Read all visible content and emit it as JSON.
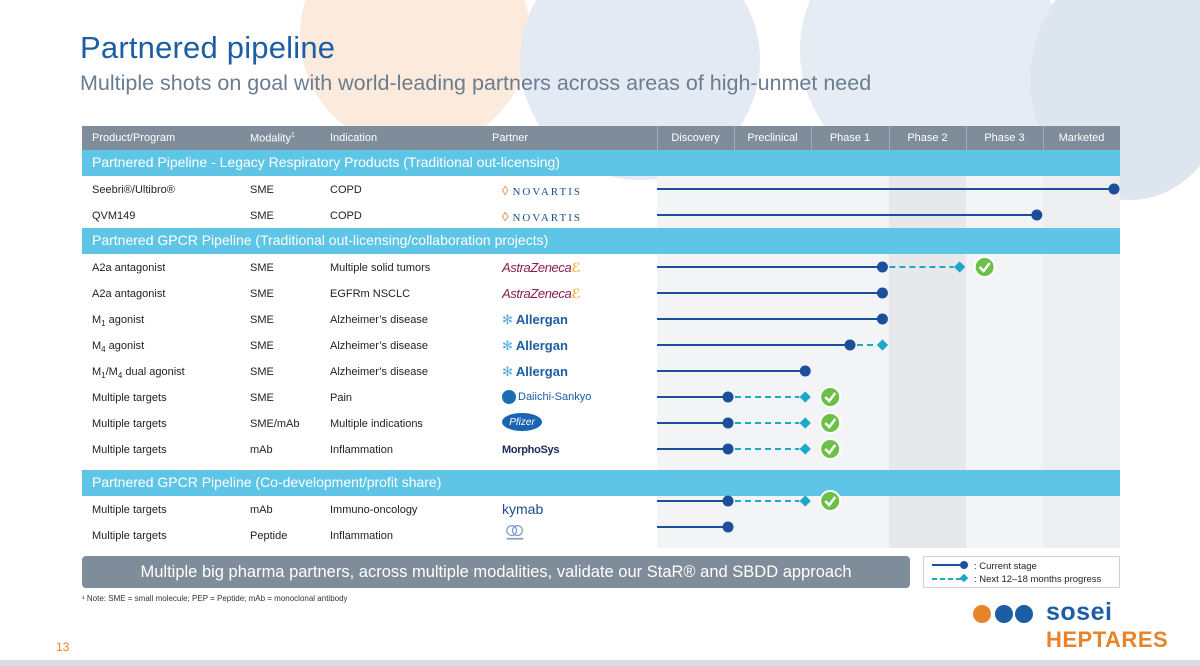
{
  "header": {
    "title": "Partnered pipeline",
    "subtitle": "Multiple shots on goal with world-leading partners across areas of high-unmet need"
  },
  "table": {
    "columns": {
      "product": "Product/Program",
      "modality": "Modality",
      "modality_sup": "1",
      "indication": "Indication",
      "partner": "Partner",
      "stages": [
        "Discovery",
        "Preclinical",
        "Phase 1",
        "Phase 2",
        "Phase 3",
        "Marketed"
      ]
    },
    "sections": [
      {
        "title": "Partnered Pipeline - Legacy Respiratory Products (Traditional out-licensing)",
        "rows": [
          {
            "product": "Seebri®/Ultibro®",
            "modality": "SME",
            "indication": "COPD",
            "partner": "NOVARTIS",
            "current_stage": "Marketed",
            "next_stage": null,
            "success_check": false
          },
          {
            "product": "QVM149",
            "modality": "SME",
            "indication": "COPD",
            "partner": "NOVARTIS",
            "current_stage": "Phase 3",
            "next_stage": null,
            "success_check": false
          }
        ]
      },
      {
        "title": "Partnered GPCR Pipeline (Traditional out-licensing/collaboration projects)",
        "rows": [
          {
            "product": "A2a antagonist",
            "modality": "SME",
            "indication": "Multiple solid tumors",
            "partner": "AstraZeneca",
            "current_stage": "Phase 1",
            "next_stage": "Phase 2",
            "success_check": true
          },
          {
            "product": "A2a antagonist",
            "modality": "SME",
            "indication": "EGFRm NSCLC",
            "partner": "AstraZeneca",
            "current_stage": "Phase 1",
            "next_stage": null,
            "success_check": false
          },
          {
            "product_main": "M",
            "product_sub": "1",
            "product_rest": " agonist",
            "modality": "SME",
            "indication": "Alzheimer’s disease",
            "partner": "Allergan",
            "current_stage": "Phase 1",
            "next_stage": null,
            "success_check": false
          },
          {
            "product_main": "M",
            "product_sub": "4",
            "product_rest": " agonist",
            "modality": "SME",
            "indication": "Alzheimer’s disease",
            "partner": "Allergan",
            "current_stage": "Phase 1",
            "next_stage": "Phase 1",
            "success_check": false
          },
          {
            "product_main": "M",
            "product_sub": "1",
            "product_mid": "/M",
            "product_sub2": "4",
            "product_rest": " dual agonist",
            "modality": "SME",
            "indication": "Alzheimer’s disease",
            "partner": "Allergan",
            "current_stage": "Preclinical",
            "next_stage": null,
            "success_check": false
          },
          {
            "product": "Multiple targets",
            "modality": "SME",
            "indication": "Pain",
            "partner": "Daiichi-Sankyo",
            "current_stage": "Discovery",
            "next_stage": "Preclinical",
            "success_check": true
          },
          {
            "product": "Multiple targets",
            "modality": "SME/mAb",
            "indication": "Multiple indications",
            "partner": "Pfizer",
            "current_stage": "Discovery",
            "next_stage": "Preclinical",
            "success_check": true
          },
          {
            "product": "Multiple targets",
            "modality": "mAb",
            "indication": "Inflammation",
            "partner": "MorphoSys",
            "current_stage": "Discovery",
            "next_stage": "Preclinical",
            "success_check": true
          }
        ]
      },
      {
        "title": "Partnered GPCR Pipeline (Co-development/profit share)",
        "rows": [
          {
            "product": "Multiple targets",
            "modality": "mAb",
            "indication": "Immuno-oncology",
            "partner": "kymab",
            "current_stage": "Discovery",
            "next_stage": "Preclinical",
            "success_check": true
          },
          {
            "product": "Multiple targets",
            "modality": "Peptide",
            "indication": "Inflammation",
            "partner": "PeptiDream",
            "current_stage": "Discovery",
            "next_stage": null,
            "success_check": false
          }
        ]
      }
    ]
  },
  "logos": {
    "novartis": "NOVARTIS",
    "astrazeneca": "AstraZeneca",
    "allergan": "Allergan",
    "daiichi": "Daiichi-Sankyo",
    "pfizer": "Pfizer",
    "morphosys": "MorphoSys",
    "kymab": "kymab"
  },
  "summary": "Multiple big pharma partners, across multiple modalities, validate our StaR® and SBDD approach",
  "legend": {
    "current": ": Current stage",
    "next": ": Next 12–18 months progress"
  },
  "footnote": "¹ Note: SME = small molecule; PEP = Peptide; mAb = monoclonal antibody",
  "page_number": "13",
  "brand": {
    "name_top": "sosei",
    "name_bottom": "HEPTARES"
  },
  "colors": {
    "title": "#1b5ea4",
    "band": "#5ec5e6",
    "header": "#7f8c99",
    "track": "#1b4f9c",
    "next": "#1ea8c8",
    "check": "#6cc04a",
    "accent_orange": "#e8832a"
  }
}
